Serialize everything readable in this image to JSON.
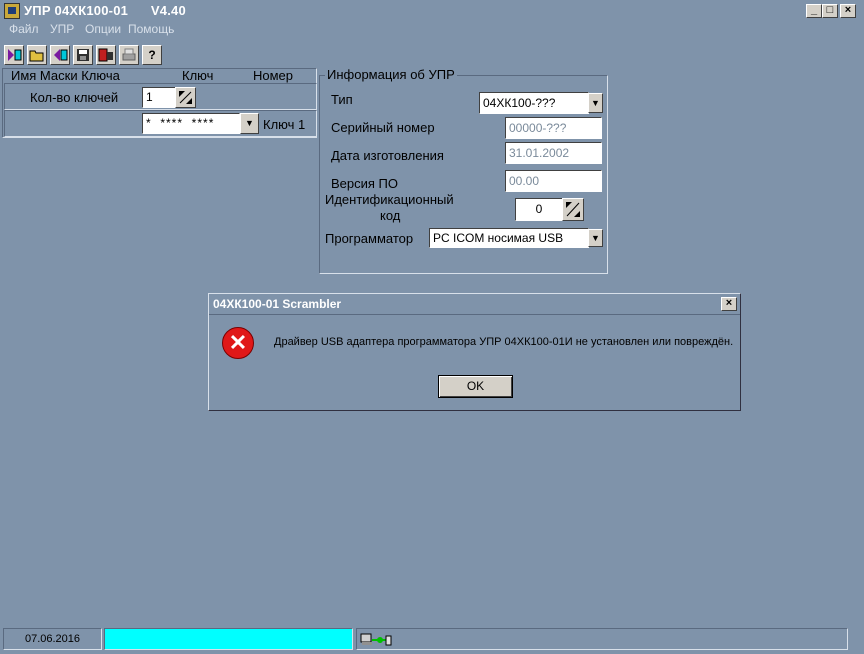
{
  "window": {
    "title": "УПР 04ХК100-01      V4.40",
    "minimize": "_",
    "maximize": "□",
    "close": "×"
  },
  "menu": [
    "Файл",
    "УПР",
    "Опции",
    "Помощь"
  ],
  "toolbar_icons": [
    "import-icon",
    "open-folder-icon",
    "export-icon",
    "save-icon",
    "program-icon",
    "print-icon",
    "help-icon"
  ],
  "left_panel": {
    "col_mask_name": "Имя Маски Ключа",
    "col_key": "Ключ",
    "col_number": "Номер",
    "key_count_label": "Кол-во ключей",
    "key_count_value": "1",
    "key_value": "*  ****  ****",
    "key_number": "Ключ 1"
  },
  "info": {
    "group_title": "Информация об УПР",
    "type_label": "Тип",
    "type_value": "04ХК100-???",
    "serial_label": "Серийный номер",
    "serial_value": "00000-???",
    "date_label": "Дата изготовления",
    "date_value": "31.01.2002",
    "version_label": "Версия ПО",
    "version_value": "00.00",
    "id_label_line1": "Идентификационный",
    "id_label_line2": "код",
    "id_value": "0",
    "programmer_label": "Программатор",
    "programmer_value": "PC ICOM носимая USB"
  },
  "dialog": {
    "title": "04ХК100-01 Scrambler",
    "close": "×",
    "message": "Драйвер USB адаптера программатора УПР 04ХК100-01И не установлен или повреждён.",
    "ok": "OK",
    "icon": "error-icon"
  },
  "status": {
    "date": "07.06.2016",
    "progress_color": "#00ffff",
    "connection_icon": "connection-icon"
  }
}
